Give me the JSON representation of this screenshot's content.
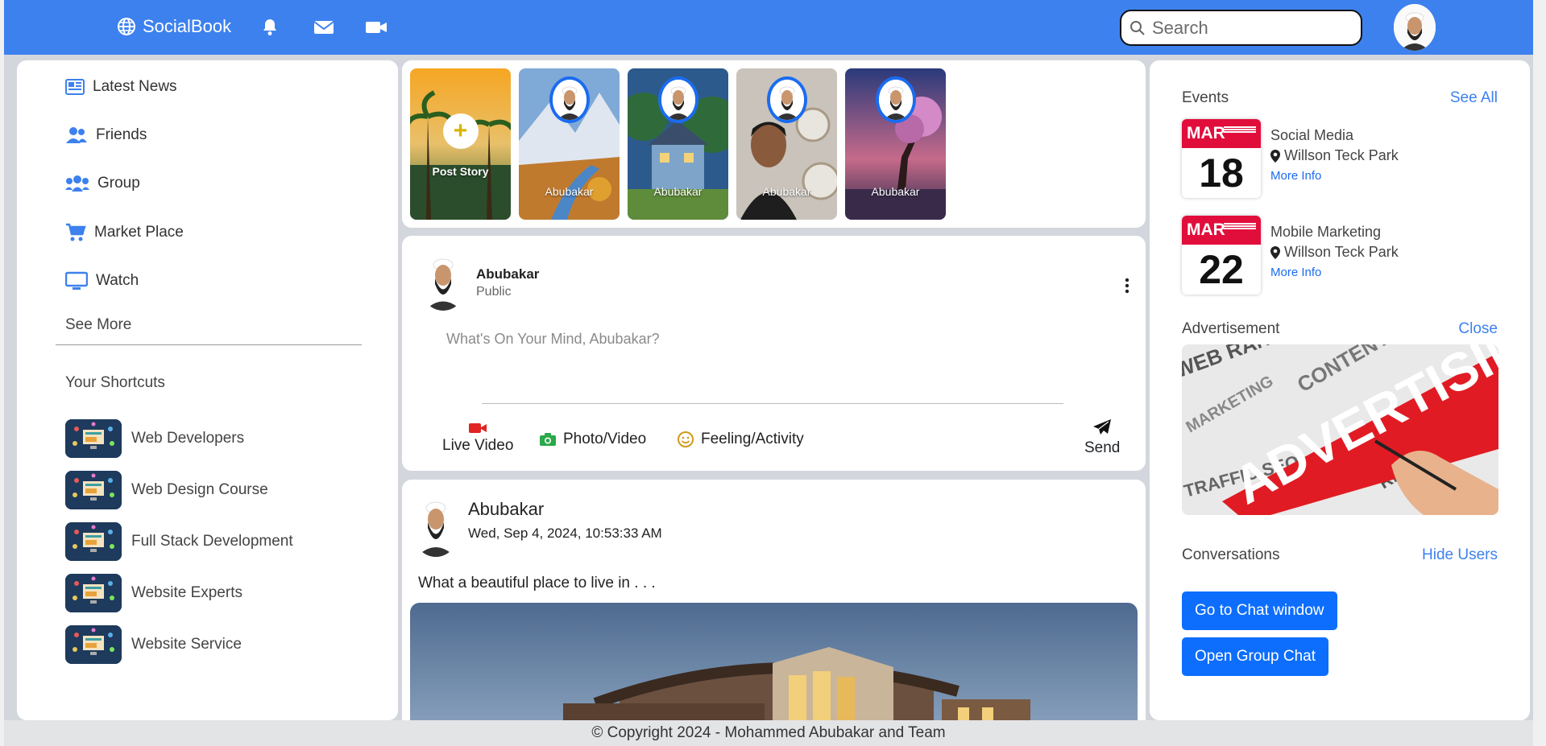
{
  "navbar": {
    "brand": "SocialBook",
    "icons": [
      "globe-icon",
      "bell-icon",
      "envelope-icon",
      "video-icon"
    ],
    "search_placeholder": "Search",
    "accent": "#3d81ee"
  },
  "sidebar": {
    "menu": [
      {
        "label": "Latest News",
        "icon": "newspaper-icon"
      },
      {
        "label": "Friends",
        "icon": "users-icon"
      },
      {
        "label": "Group",
        "icon": "group-icon"
      },
      {
        "label": "Market Place",
        "icon": "cart-icon"
      },
      {
        "label": "Watch",
        "icon": "monitor-icon"
      }
    ],
    "see_more": "See More",
    "shortcuts_title": "Your Shortcuts",
    "shortcuts": [
      {
        "label": "Web Developers"
      },
      {
        "label": "Web Design Course"
      },
      {
        "label": "Full Stack Development"
      },
      {
        "label": "Website Experts"
      },
      {
        "label": "Website Service"
      }
    ]
  },
  "stories": {
    "post_story_label": "Post Story",
    "items": [
      {
        "name": "Abubakar"
      },
      {
        "name": "Abubakar"
      },
      {
        "name": "Abubakar"
      },
      {
        "name": "Abubakar"
      }
    ]
  },
  "create_post": {
    "user_name": "Abubakar",
    "privacy": "Public",
    "placeholder": "What's On Your Mind, Abubakar?",
    "actions": {
      "live_video": "Live Video",
      "photo_video": "Photo/Video",
      "feeling": "Feeling/Activity",
      "send": "Send"
    }
  },
  "post": {
    "author": "Abubakar",
    "timestamp": "Wed, Sep 4, 2024, 10:53:33 AM",
    "text": "What a beautiful place to live in . . ."
  },
  "right": {
    "events_title": "Events",
    "see_all": "See All",
    "events": [
      {
        "month": "MAR",
        "day": "18",
        "title": "Social Media",
        "location": "Willson Teck Park",
        "more": "More Info"
      },
      {
        "month": "MAR",
        "day": "22",
        "title": "Mobile Marketing",
        "location": "Willson Teck Park",
        "more": "More Info"
      }
    ],
    "advertisement_title": "Advertisement",
    "close": "Close",
    "ad_word": "ADVERTISING",
    "conversations_title": "Conversations",
    "hide_users": "Hide Users",
    "chat_button": "Go to Chat window",
    "group_chat_button": "Open Group Chat"
  },
  "footer": {
    "text": "© Copyright 2024 - Mohammed Abubakar and Team"
  }
}
